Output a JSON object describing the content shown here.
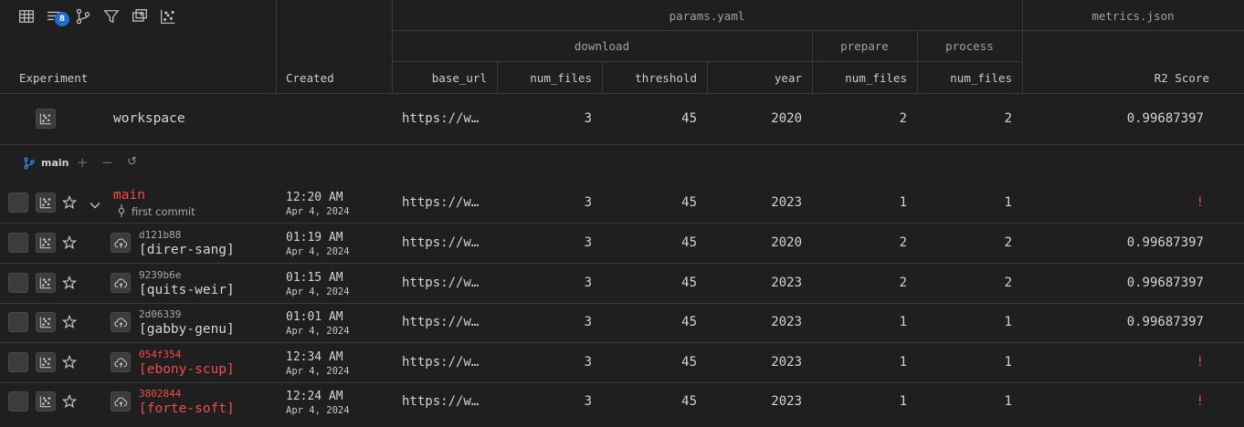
{
  "toolbar": {
    "icons": [
      "table-icon",
      "sort-icon",
      "branch-icon",
      "filter-icon",
      "upload-icon",
      "scatter-icon"
    ],
    "sort_badge": "8"
  },
  "header": {
    "experiment": "Experiment",
    "created": "Created",
    "params_group": "params.yaml",
    "metrics_group": "metrics.json",
    "download_group": "download",
    "prepare_group": "prepare",
    "process_group": "process",
    "columns": {
      "base_url": "base_url",
      "num_files_download": "num_files",
      "threshold": "threshold",
      "year": "year",
      "num_files_prepare": "num_files",
      "num_files_process": "num_files",
      "r2": "R2 Score"
    }
  },
  "workspace": {
    "name": "workspace",
    "base_url": "https://w…",
    "num_files": "3",
    "threshold": "45",
    "year": "2020",
    "prepare_num_files": "2",
    "process_num_files": "2",
    "r2": "0.99687397"
  },
  "branch": {
    "name": "main",
    "add": "+",
    "remove": "−",
    "reset": "↺"
  },
  "main_row": {
    "name": "main",
    "commit_message": "first commit",
    "time": "12:20 AM",
    "date": "Apr 4, 2024",
    "base_url": "https://w…",
    "num_files": "3",
    "threshold": "45",
    "year": "2023",
    "prepare_num_files": "1",
    "process_num_files": "1",
    "r2": "!"
  },
  "experiments": [
    {
      "sha": "d121b88",
      "name": "[direr-sang]",
      "time": "01:19 AM",
      "date": "Apr 4, 2024",
      "base_url": "https://w…",
      "num_files": "3",
      "threshold": "45",
      "year": "2020",
      "prepare_num_files": "2",
      "process_num_files": "2",
      "r2": "0.99687397",
      "error": false
    },
    {
      "sha": "9239b6e",
      "name": "[quits-weir]",
      "time": "01:15 AM",
      "date": "Apr 4, 2024",
      "base_url": "https://w…",
      "num_files": "3",
      "threshold": "45",
      "year": "2023",
      "prepare_num_files": "2",
      "process_num_files": "2",
      "r2": "0.99687397",
      "error": false
    },
    {
      "sha": "2d06339",
      "name": "[gabby-genu]",
      "time": "01:01 AM",
      "date": "Apr 4, 2024",
      "base_url": "https://w…",
      "num_files": "3",
      "threshold": "45",
      "year": "2023",
      "prepare_num_files": "1",
      "process_num_files": "1",
      "r2": "0.99687397",
      "error": false
    },
    {
      "sha": "054f354",
      "name": "[ebony-scup]",
      "time": "12:34 AM",
      "date": "Apr 4, 2024",
      "base_url": "https://w…",
      "num_files": "3",
      "threshold": "45",
      "year": "2023",
      "prepare_num_files": "1",
      "process_num_files": "1",
      "r2": "!",
      "error": true
    },
    {
      "sha": "3802844",
      "name": "[forte-soft]",
      "time": "12:24 AM",
      "date": "Apr 4, 2024",
      "base_url": "https://w…",
      "num_files": "3",
      "threshold": "45",
      "year": "2023",
      "prepare_num_files": "1",
      "process_num_files": "1",
      "r2": "!",
      "error": true
    }
  ],
  "colors": {
    "background": "#1f1f1f",
    "error": "#f14c4c",
    "badge": "#1a6fd1",
    "branch_icon": "#3794ff"
  }
}
